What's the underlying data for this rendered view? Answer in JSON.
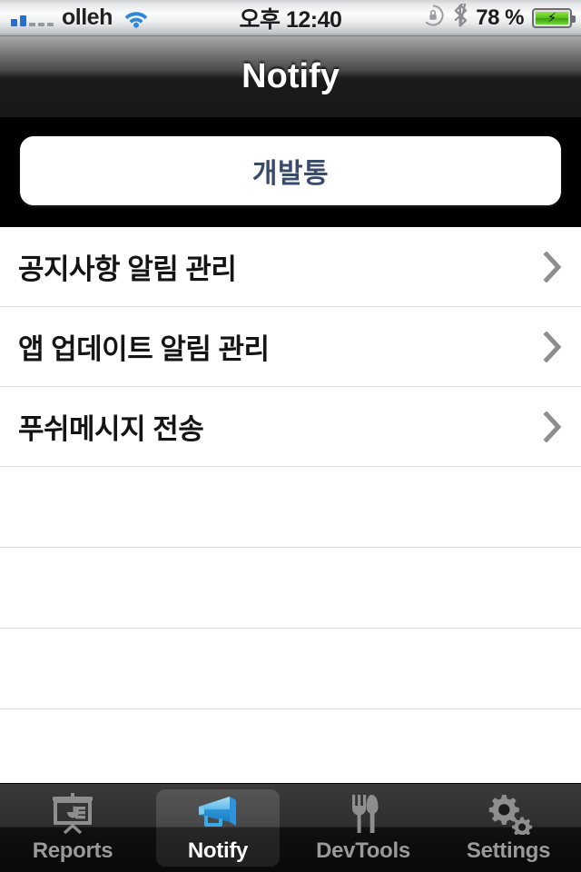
{
  "statusbar": {
    "signal_icon": "signal-bars-icon",
    "signal_bars_on": 2,
    "signal_bars_total": 5,
    "carrier": "olleh",
    "wifi_icon": "wifi-icon",
    "time": "오후 12:40",
    "rotation_lock_icon": "rotation-lock-icon",
    "bluetooth_icon": "bluetooth-icon",
    "battery_percent": "78 %",
    "battery_icon": "battery-charging-icon"
  },
  "navbar": {
    "title": "Notify"
  },
  "header": {
    "button_label": "개발통",
    "button_text_color": "#3a4a6b"
  },
  "list": {
    "chevron_icon": "chevron-right-icon",
    "items": [
      {
        "label": "공지사항 알림 관리",
        "has_chevron": true
      },
      {
        "label": "앱 업데이트 알림 관리",
        "has_chevron": true
      },
      {
        "label": "푸쉬메시지 전송",
        "has_chevron": true
      }
    ],
    "empty_rows": 4
  },
  "tabbar": {
    "active_index": 1,
    "active_color": "#ffffff",
    "inactive_color": "#9a9a9a",
    "accent_color": "#3ca9e8",
    "tabs": [
      {
        "label": "Reports",
        "icon": "presentation-chart-icon",
        "active": false
      },
      {
        "label": "Notify",
        "icon": "megaphone-icon",
        "active": true
      },
      {
        "label": "DevTools",
        "icon": "fork-knife-icon",
        "active": false
      },
      {
        "label": "Settings",
        "icon": "gears-icon",
        "active": false
      }
    ]
  }
}
